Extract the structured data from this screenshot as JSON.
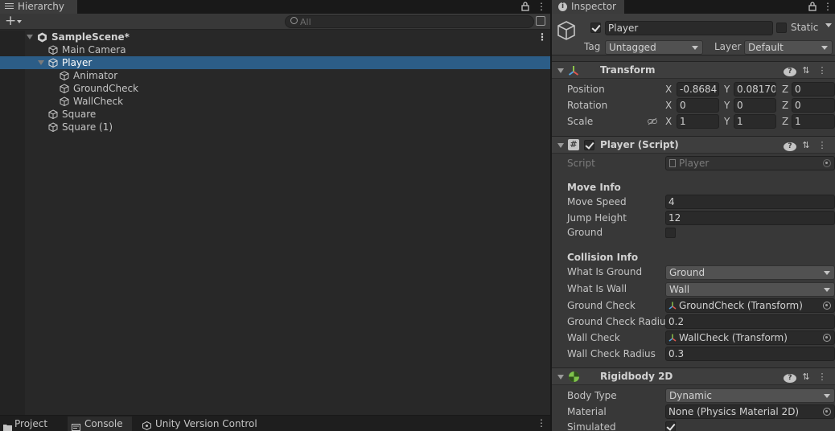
{
  "hierarchy": {
    "tab_label": "Hierarchy",
    "add_label": "+",
    "search_placeholder": "All",
    "scene_name": "SampleScene*",
    "items": [
      {
        "label": "Main Camera"
      },
      {
        "label": "Player"
      },
      {
        "label": "Animator"
      },
      {
        "label": "GroundCheck"
      },
      {
        "label": "WallCheck"
      },
      {
        "label": "Square"
      },
      {
        "label": "Square (1)"
      }
    ]
  },
  "bottom_tabs": [
    {
      "label": "Project"
    },
    {
      "label": "Console"
    },
    {
      "label": "Unity Version Control"
    }
  ],
  "inspector": {
    "tab_label": "Inspector",
    "object_name": "Player",
    "static_label": "Static",
    "tag_label": "Tag",
    "tag_value": "Untagged",
    "layer_label": "Layer",
    "layer_value": "Default",
    "transform": {
      "title": "Transform",
      "position_label": "Position",
      "rotation_label": "Rotation",
      "scale_label": "Scale",
      "axis_x": "X",
      "axis_y": "Y",
      "axis_z": "Z",
      "position": {
        "x": "-0.8684",
        "y": "0.08170",
        "z": "0"
      },
      "rotation": {
        "x": "0",
        "y": "0",
        "z": "0"
      },
      "scale": {
        "x": "1",
        "y": "1",
        "z": "1"
      }
    },
    "player_script": {
      "title": "Player (Script)",
      "script_label": "Script",
      "script_value": "Player",
      "move_info_title": "Move Info",
      "move_speed_label": "Move Speed",
      "move_speed_value": "4",
      "jump_height_label": "Jump Height",
      "jump_height_value": "12",
      "ground_label": "Ground",
      "collision_info_title": "Collision Info",
      "what_is_ground_label": "What Is Ground",
      "what_is_ground_value": "Ground",
      "what_is_wall_label": "What Is Wall",
      "what_is_wall_value": "Wall",
      "ground_check_label": "Ground Check",
      "ground_check_value": "GroundCheck (Transform)",
      "ground_check_radius_label": "Ground Check Radius",
      "ground_check_radius_value": "0.2",
      "wall_check_label": "Wall Check",
      "wall_check_value": "WallCheck (Transform)",
      "wall_check_radius_label": "Wall Check Radius",
      "wall_check_radius_value": "0.3"
    },
    "rigidbody": {
      "title": "Rigidbody 2D",
      "body_type_label": "Body Type",
      "body_type_value": "Dynamic",
      "material_label": "Material",
      "material_value": "None (Physics Material 2D)",
      "simulated_label": "Simulated"
    }
  },
  "colors": {
    "selection": "#2c5d87",
    "panel_bg": "#282828",
    "inspector_bg": "#383838",
    "transform_icon_green": "#8bc34a",
    "rigidbody_icon_green": "#7ec24b"
  }
}
